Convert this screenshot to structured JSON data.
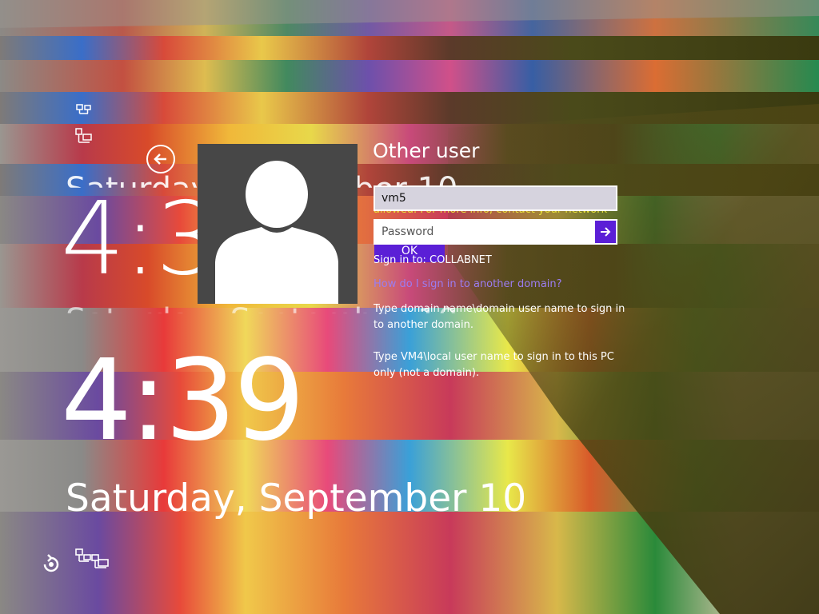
{
  "clock": {
    "time": "4:39",
    "date": "Saturday, September 10",
    "ghost_time": "4:3",
    "ghost_date": "Saturday, September 10"
  },
  "login": {
    "title": "Other user",
    "username_value": "vm5",
    "password_placeholder": "Password",
    "ok_label": "OK",
    "ghost_warning": "allowed. For more info, contact your network",
    "sign_in_to": "Sign in to: COLLABNET",
    "domain_help_link": "How do I sign in to another domain?",
    "help_domain": "Type domain name\\domain user name to sign in to another domain.",
    "help_local": "Type VM4\\local user name to sign in to this PC only (not a domain)."
  },
  "icons": {
    "back": "back-arrow-icon",
    "submit": "arrow-right-icon",
    "ease_of_access": "ease-of-access-icon",
    "network": "network-icon",
    "avatar": "user-silhouette-icon"
  },
  "colors": {
    "accent": "#5b1fd6",
    "link": "#9b7cf0",
    "avatar_bg": "#474747",
    "username_bg": "#d6d3de"
  }
}
